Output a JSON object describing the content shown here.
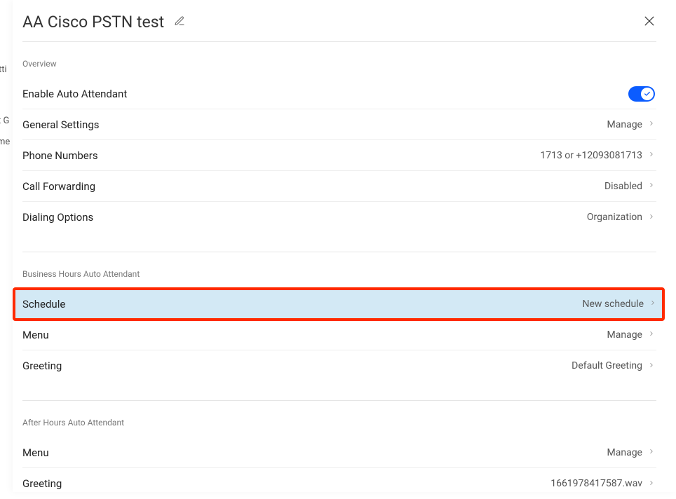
{
  "bg": {
    "t1": "tti",
    "t2": "t G",
    "t3": "me"
  },
  "header": {
    "title": "AA Cisco PSTN test"
  },
  "overview": {
    "label": "Overview",
    "enable": {
      "label": "Enable Auto Attendant",
      "on": true
    },
    "general": {
      "label": "General Settings",
      "value": "Manage"
    },
    "phone": {
      "label": "Phone Numbers",
      "value": "1713 or +12093081713"
    },
    "forward": {
      "label": "Call Forwarding",
      "value": "Disabled"
    },
    "dialing": {
      "label": "Dialing Options",
      "value": "Organization"
    }
  },
  "business": {
    "label": "Business Hours Auto Attendant",
    "schedule": {
      "label": "Schedule",
      "value": "New schedule"
    },
    "menu": {
      "label": "Menu",
      "value": "Manage"
    },
    "greeting": {
      "label": "Greeting",
      "value": "Default Greeting"
    }
  },
  "after": {
    "label": "After Hours Auto Attendant",
    "menu": {
      "label": "Menu",
      "value": "Manage"
    },
    "greeting": {
      "label": "Greeting",
      "value": "1661978417587.wav"
    }
  }
}
